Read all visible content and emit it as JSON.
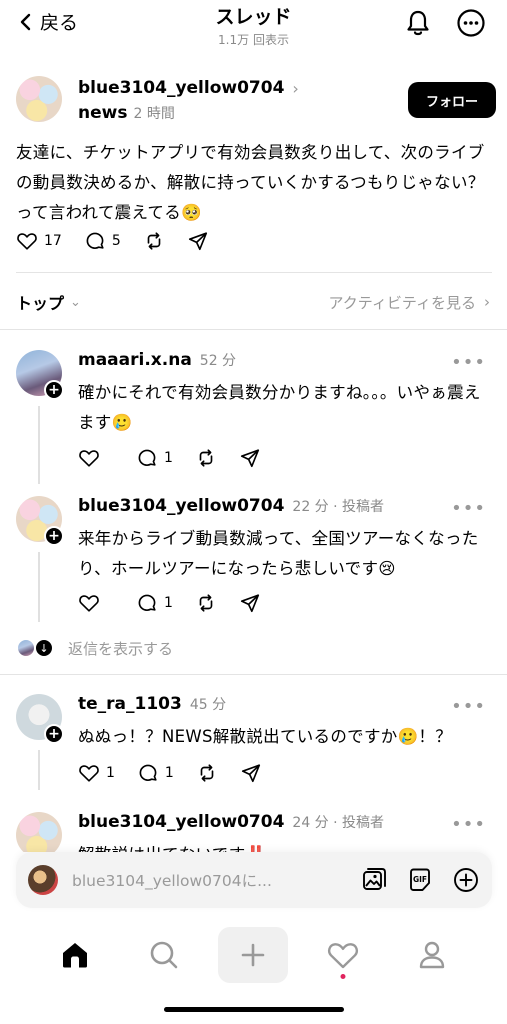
{
  "header": {
    "back_label": "戻る",
    "title": "スレッド",
    "subtitle": "1.1万 回表示"
  },
  "post": {
    "author": "blue3104_yellow0704",
    "sub_name": "news",
    "time": "2 時間",
    "follow_label": "フォロー",
    "text": "友達に、チケットアプリで有効会員数炙り出して、次のライブの動員数決めるか、解散に持っていくかするつもりじゃない？って言われて震えてる🥺",
    "likes": "17",
    "comments": "5"
  },
  "sort": {
    "label": "トップ",
    "activity_label": "アクティビティを見る"
  },
  "replies": [
    {
      "author": "maaari.x.na",
      "time": "52 分",
      "text": "確かにそれで有効会員数分かりますね。。。いやぁ震えます🥲",
      "likes": "",
      "comments": "1"
    },
    {
      "author": "blue3104_yellow0704",
      "time": "22 分 · 投稿者",
      "text": "来年からライブ動員数減って、全国ツアーなくなったり、ホールツアーになったら悲しいです😢",
      "likes": "",
      "comments": "1"
    },
    {
      "author": "te_ra_1103",
      "time": "45 分",
      "text": "ぬぬっ！？NEWS解散説出ているのですか🥲！？",
      "likes": "1",
      "comments": "1"
    },
    {
      "author": "blue3104_yellow0704",
      "time": "24 分 · 投稿者",
      "text": "解散説は出てないです‼️",
      "likes": "",
      "comments": ""
    }
  ],
  "show_replies_label": "返信を表示する",
  "composer": {
    "placeholder": "blue3104_yellow0704に..."
  },
  "colors": {
    "notification_dot": "#e0245e",
    "secondary_text": "#8a8a8a"
  }
}
